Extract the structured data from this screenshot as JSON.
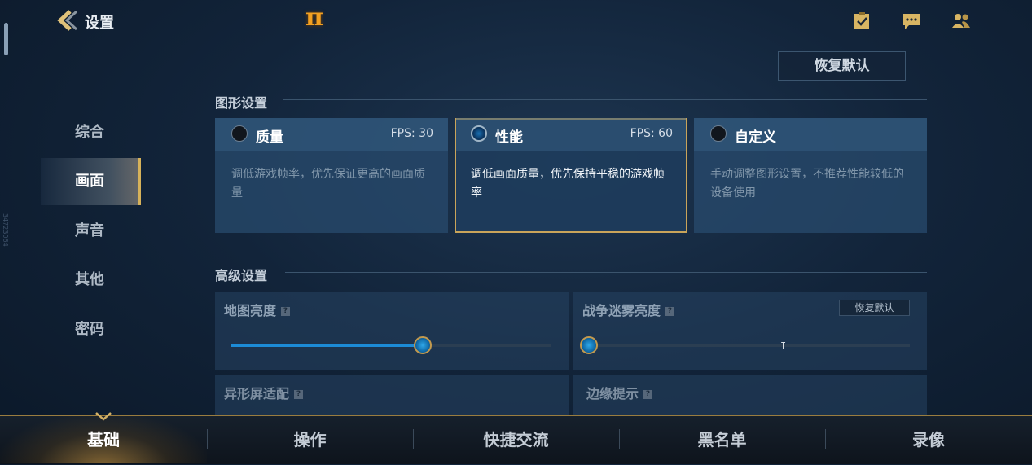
{
  "header": {
    "title": "设置",
    "logo_text": "π",
    "icons": [
      "task-icon",
      "chat-icon",
      "friends-icon"
    ]
  },
  "restore_default_label": "恢复默认",
  "side_label": "34723064",
  "nav": {
    "items": [
      {
        "label": "综合"
      },
      {
        "label": "画面"
      },
      {
        "label": "声音"
      },
      {
        "label": "其他"
      },
      {
        "label": "密码"
      }
    ],
    "active": "画面"
  },
  "graphics": {
    "section_title": "图形设置",
    "options": [
      {
        "name": "质量",
        "fps": "FPS: 30",
        "desc": "调低游戏帧率，优先保证更高的画面质量",
        "selected": false
      },
      {
        "name": "性能",
        "fps": "FPS: 60",
        "desc": "调低画面质量，优先保持平稳的游戏帧率",
        "selected": true
      },
      {
        "name": "自定义",
        "fps": "",
        "desc": "手动调整图形设置，不推荐性能较低的设备使用",
        "selected": false
      }
    ]
  },
  "advanced": {
    "section_title": "高级设置",
    "map_brightness": {
      "label": "地图亮度",
      "value": 0.6
    },
    "fog_brightness": {
      "label": "战争迷雾亮度",
      "value": 0.0,
      "restore_label": "恢复默认"
    },
    "special_screen": {
      "label": "异形屏适配"
    },
    "edge_hint": {
      "label": "边缘提示"
    }
  },
  "bottom_tabs": {
    "items": [
      {
        "label": "基础"
      },
      {
        "label": "操作"
      },
      {
        "label": "快捷交流"
      },
      {
        "label": "黑名单"
      },
      {
        "label": "录像"
      }
    ],
    "active": "基础"
  },
  "colors": {
    "accent_gold": "#c9a45a",
    "accent_blue": "#1c8bd6"
  }
}
